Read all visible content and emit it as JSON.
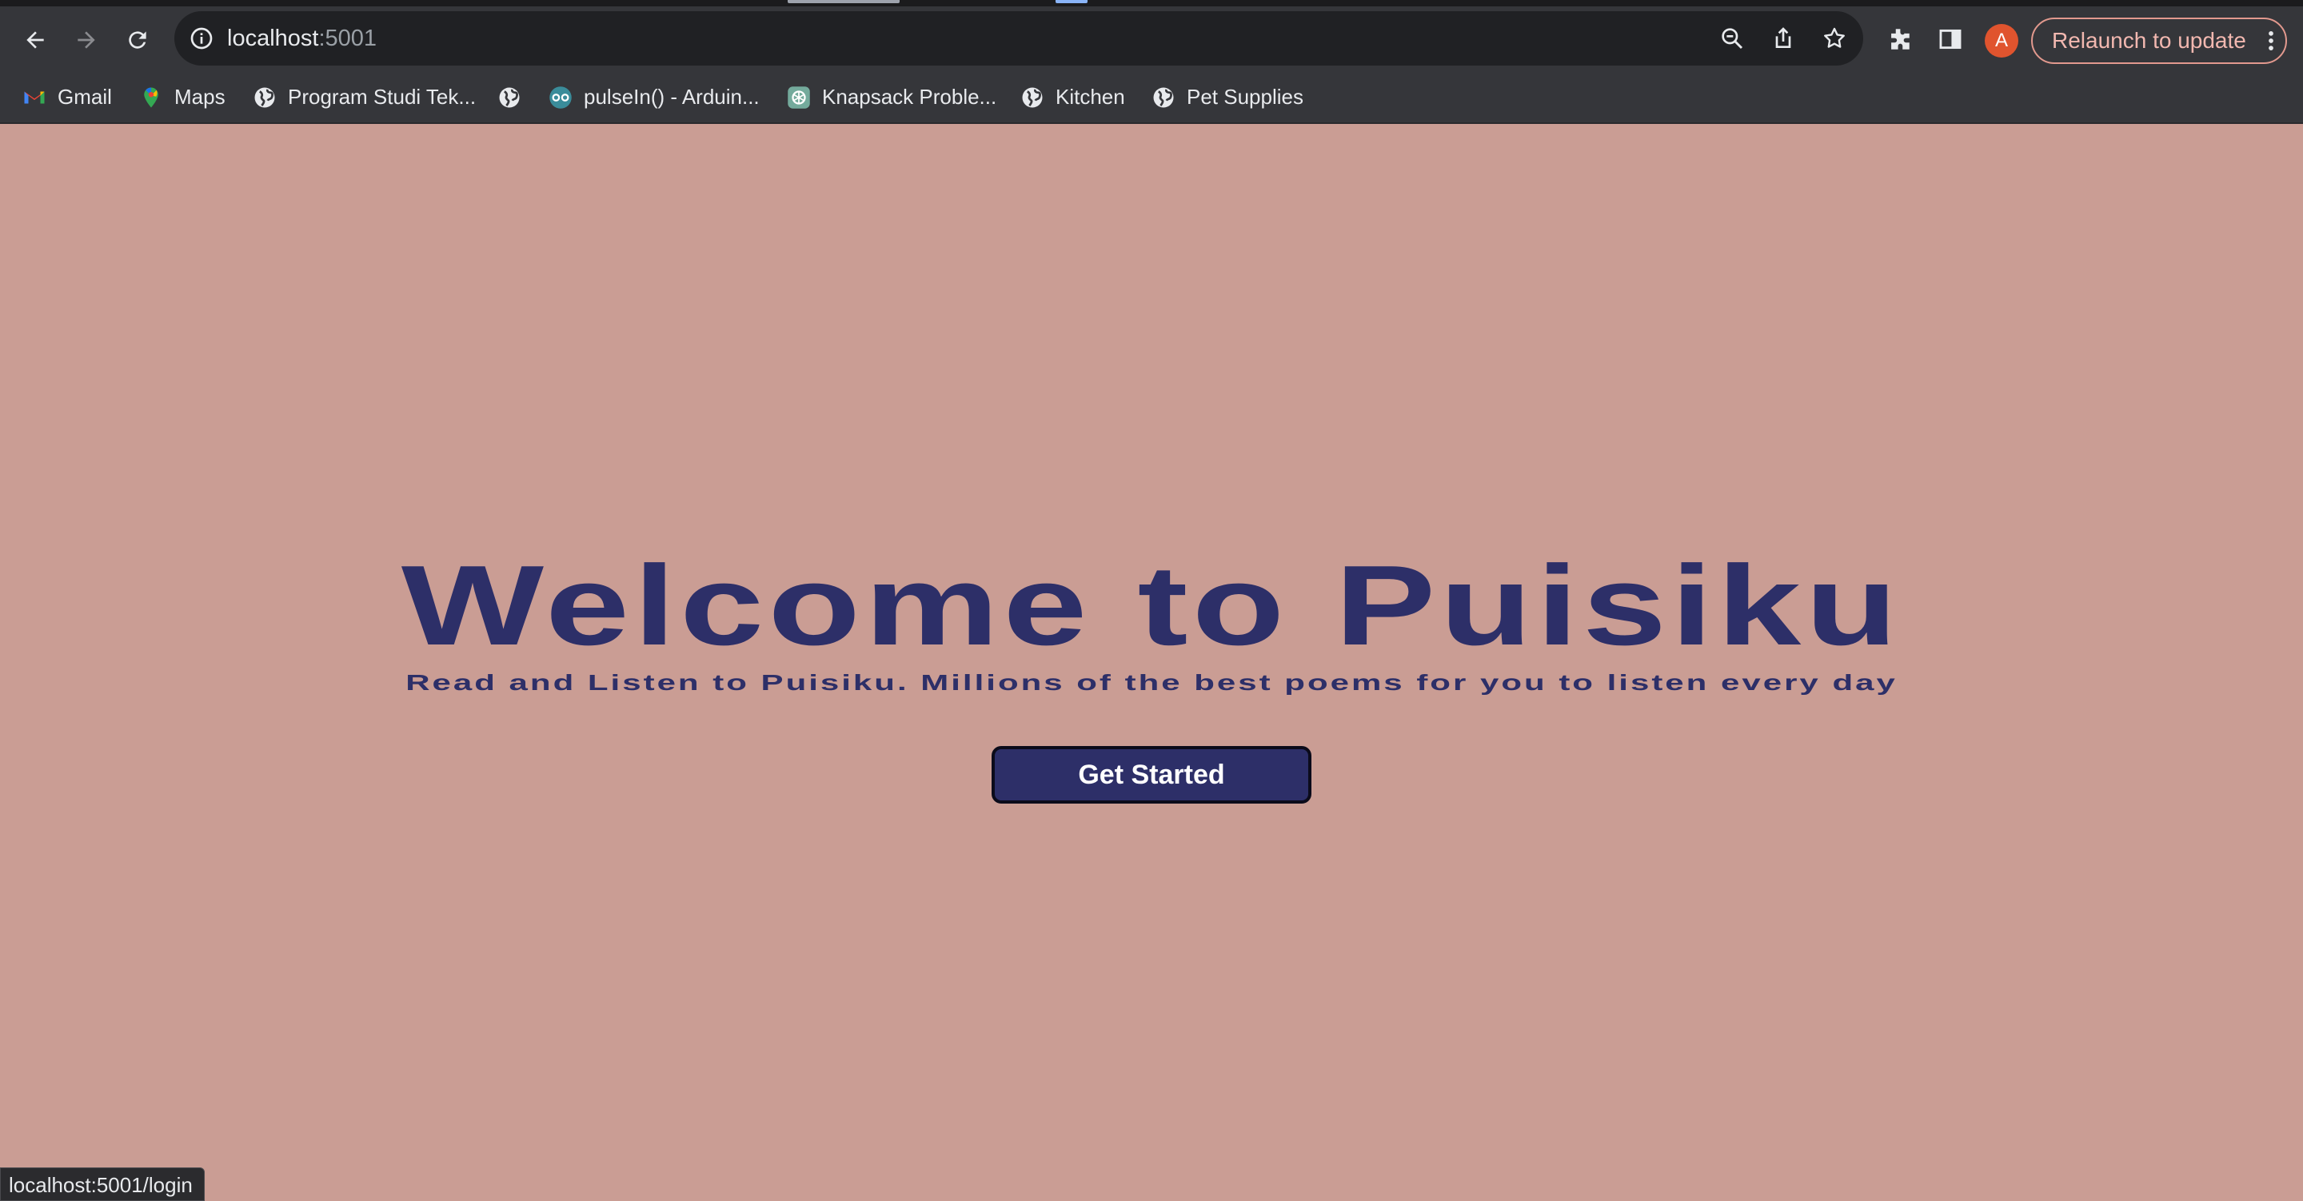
{
  "browser": {
    "url_host": "localhost",
    "url_port": ":5001",
    "relaunch_label": "Relaunch to update",
    "profile_initial": "A",
    "bookmarks": [
      {
        "label": "Gmail",
        "icon": "gmail-icon"
      },
      {
        "label": "Maps",
        "icon": "maps-icon"
      },
      {
        "label": "Program Studi Tek...",
        "icon": "globe-icon"
      },
      {
        "label": "",
        "icon": "globe-icon"
      },
      {
        "label": "pulseIn() - Arduin...",
        "icon": "arduino-icon"
      },
      {
        "label": "Knapsack Proble...",
        "icon": "chatgpt-icon"
      },
      {
        "label": "Kitchen",
        "icon": "globe-icon"
      },
      {
        "label": "Pet Supplies",
        "icon": "globe-icon"
      }
    ],
    "status_url": "localhost:5001/login"
  },
  "page": {
    "title": "Welcome to Puisiku",
    "subtitle": "Read and Listen to Puisiku. Millions of the best poems for you to listen every day",
    "cta_label": "Get Started"
  },
  "colors": {
    "background": "#ca9d94",
    "primary": "#2d2f68",
    "chrome": "#35363a",
    "avatar": "#e0542e"
  }
}
